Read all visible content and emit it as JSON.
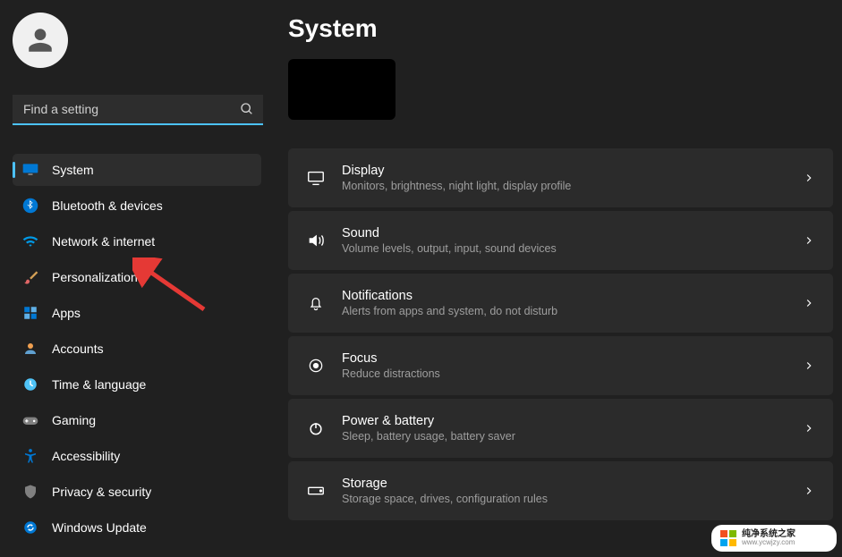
{
  "search": {
    "placeholder": "Find a setting"
  },
  "nav": [
    {
      "label": "System",
      "icon": "system",
      "selected": true
    },
    {
      "label": "Bluetooth & devices",
      "icon": "bluetooth"
    },
    {
      "label": "Network & internet",
      "icon": "wifi"
    },
    {
      "label": "Personalization",
      "icon": "brush"
    },
    {
      "label": "Apps",
      "icon": "apps"
    },
    {
      "label": "Accounts",
      "icon": "accounts"
    },
    {
      "label": "Time & language",
      "icon": "clock"
    },
    {
      "label": "Gaming",
      "icon": "gaming"
    },
    {
      "label": "Accessibility",
      "icon": "accessibility"
    },
    {
      "label": "Privacy & security",
      "icon": "privacy"
    },
    {
      "label": "Windows Update",
      "icon": "update"
    }
  ],
  "page": {
    "title": "System"
  },
  "cards": [
    {
      "title": "Display",
      "sub": "Monitors, brightness, night light, display profile",
      "icon": "display"
    },
    {
      "title": "Sound",
      "sub": "Volume levels, output, input, sound devices",
      "icon": "sound"
    },
    {
      "title": "Notifications",
      "sub": "Alerts from apps and system, do not disturb",
      "icon": "bell"
    },
    {
      "title": "Focus",
      "sub": "Reduce distractions",
      "icon": "focus"
    },
    {
      "title": "Power & battery",
      "sub": "Sleep, battery usage, battery saver",
      "icon": "power"
    },
    {
      "title": "Storage",
      "sub": "Storage space, drives, configuration rules",
      "icon": "storage"
    }
  ],
  "watermark": {
    "line1": "纯净系统之家",
    "line2": "www.ycwjzy.com"
  },
  "colors": {
    "accent": "#4cc2ff"
  }
}
